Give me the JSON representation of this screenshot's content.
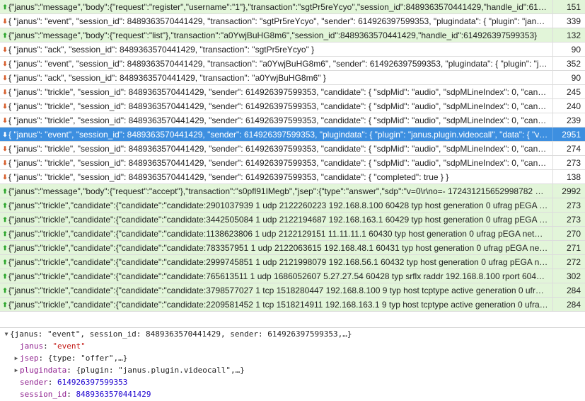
{
  "frames": [
    {
      "dir": "up",
      "type": "sent",
      "text": "{\"janus\":\"message\",\"body\":{\"request\":\"register\",\"username\":\"1\"},\"transaction\":\"sgtPr5reYcyo\",\"session_id\":8489363570441429,\"handle_id\":614926…",
      "length": "151"
    },
    {
      "dir": "down",
      "type": "received",
      "text": "{ \"janus\": \"event\", \"session_id\": 8489363570441429, \"transaction\": \"sgtPr5reYcyo\", \"sender\": 614926397599353, \"plugindata\": { \"plugin\": \"janus.pl…",
      "length": "339"
    },
    {
      "dir": "up",
      "type": "sent",
      "text": "{\"janus\":\"message\",\"body\":{\"request\":\"list\"},\"transaction\":\"a0YwjBuHG8m6\",\"session_id\":8489363570441429,\"handle_id\":614926397599353}",
      "length": "132"
    },
    {
      "dir": "down",
      "type": "received",
      "text": "{ \"janus\": \"ack\", \"session_id\": 8489363570441429, \"transaction\": \"sgtPr5reYcyo\" }",
      "length": "90"
    },
    {
      "dir": "down",
      "type": "received",
      "text": "{ \"janus\": \"event\", \"session_id\": 8489363570441429, \"transaction\": \"a0YwjBuHG8m6\", \"sender\": 614926397599353, \"plugindata\": { \"plugin\": \"janu…",
      "length": "352"
    },
    {
      "dir": "down",
      "type": "received",
      "text": "{ \"janus\": \"ack\", \"session_id\": 8489363570441429, \"transaction\": \"a0YwjBuHG8m6\" }",
      "length": "90"
    },
    {
      "dir": "down",
      "type": "received",
      "text": "{ \"janus\": \"trickle\", \"session_id\": 8489363570441429, \"sender\": 614926397599353, \"candidate\": { \"sdpMid\": \"audio\", \"sdpMLineIndex\": 0, \"candid…",
      "length": "245"
    },
    {
      "dir": "down",
      "type": "received",
      "text": "{ \"janus\": \"trickle\", \"session_id\": 8489363570441429, \"sender\": 614926397599353, \"candidate\": { \"sdpMid\": \"audio\", \"sdpMLineIndex\": 0, \"candid…",
      "length": "240"
    },
    {
      "dir": "down",
      "type": "received",
      "text": "{ \"janus\": \"trickle\", \"session_id\": 8489363570441429, \"sender\": 614926397599353, \"candidate\": { \"sdpMid\": \"audio\", \"sdpMLineIndex\": 0, \"candid…",
      "length": "239"
    },
    {
      "dir": "down",
      "type": "selected",
      "text": "{ \"janus\": \"event\", \"session_id\": 8489363570441429, \"sender\": 614926397599353, \"plugindata\": { \"plugin\": \"janus.plugin.videocall\", \"data\": { \"vide…",
      "length": "2951"
    },
    {
      "dir": "down",
      "type": "received",
      "text": "{ \"janus\": \"trickle\", \"session_id\": 8489363570441429, \"sender\": 614926397599353, \"candidate\": { \"sdpMid\": \"audio\", \"sdpMLineIndex\": 0, \"candid…",
      "length": "274"
    },
    {
      "dir": "down",
      "type": "received",
      "text": "{ \"janus\": \"trickle\", \"session_id\": 8489363570441429, \"sender\": 614926397599353, \"candidate\": { \"sdpMid\": \"audio\", \"sdpMLineIndex\": 0, \"candid…",
      "length": "273"
    },
    {
      "dir": "down",
      "type": "received",
      "text": "{ \"janus\": \"trickle\", \"session_id\": 8489363570441429, \"sender\": 614926397599353, \"candidate\": { \"completed\": true } }",
      "length": "138"
    },
    {
      "dir": "up",
      "type": "sent",
      "text": "{\"janus\":\"message\",\"body\":{\"request\":\"accept\"},\"transaction\":\"s0pfl91IMegb\",\"jsep\":{\"type\":\"answer\",\"sdp\":\"v=0\\r\\no=- 172431215652998782 2 I…",
      "length": "2992"
    },
    {
      "dir": "up",
      "type": "sent",
      "text": "{\"janus\":\"trickle\",\"candidate\":{\"candidate\":\"candidate:2901037939 1 udp 2122260223 192.168.8.100 60428 typ host generation 0 ufrag pEGA net…",
      "length": "273"
    },
    {
      "dir": "up",
      "type": "sent",
      "text": "{\"janus\":\"trickle\",\"candidate\":{\"candidate\":\"candidate:3442505084 1 udp 2122194687 192.168.163.1 60429 typ host generation 0 ufrag pEGA net…",
      "length": "273"
    },
    {
      "dir": "up",
      "type": "sent",
      "text": "{\"janus\":\"trickle\",\"candidate\":{\"candidate\":\"candidate:1138623806 1 udp 2122129151 11.11.11.1 60430 typ host generation 0 ufrag pEGA networ…",
      "length": "270"
    },
    {
      "dir": "up",
      "type": "sent",
      "text": "{\"janus\":\"trickle\",\"candidate\":{\"candidate\":\"candidate:783357951 1 udp 2122063615 192.168.48.1 60431 typ host generation 0 ufrag pEGA netw…",
      "length": "271"
    },
    {
      "dir": "up",
      "type": "sent",
      "text": "{\"janus\":\"trickle\",\"candidate\":{\"candidate\":\"candidate:2999745851 1 udp 2121998079 192.168.56.1 60432 typ host generation 0 ufrag pEGA net…",
      "length": "272"
    },
    {
      "dir": "up",
      "type": "sent",
      "text": "{\"janus\":\"trickle\",\"candidate\":{\"candidate\":\"candidate:765613511 1 udp 1686052607 5.27.27.54 60428 typ srflx raddr 192.168.8.100 rport 60428 …",
      "length": "302"
    },
    {
      "dir": "up",
      "type": "sent",
      "text": "{\"janus\":\"trickle\",\"candidate\":{\"candidate\":\"candidate:3798577027 1 tcp 1518280447 192.168.8.100 9 typ host tcptype active generation 0 ufrag …",
      "length": "284"
    },
    {
      "dir": "up",
      "type": "sent",
      "text": "{\"janus\":\"trickle\",\"candidate\":{\"candidate\":\"candidate:2209581452 1 tcp 1518214911 192.168.163.1 9 typ host tcptype active generation 0 ufrag …",
      "length": "284"
    }
  ],
  "detail": {
    "summary": "{janus: \"event\", session_id: 8489363570441429, sender: 614926397599353,…}",
    "lines": [
      {
        "kind": "string",
        "key": "janus",
        "value": "\"event\"",
        "expander": false
      },
      {
        "kind": "object",
        "key": "jsep",
        "value": "{type: \"offer\",…}",
        "expander": true
      },
      {
        "kind": "object",
        "key": "plugindata",
        "value": "{plugin: \"janus.plugin.videocall\",…}",
        "expander": true
      },
      {
        "kind": "number",
        "key": "sender",
        "value": "614926397599353",
        "expander": false
      },
      {
        "kind": "number",
        "key": "session_id",
        "value": "8489363570441429",
        "expander": false
      }
    ]
  },
  "icons": {
    "sent_arrow": "arrow-up-icon",
    "received_arrow": "arrow-down-icon",
    "expanded_triangle": "triangle-down-icon",
    "collapsed_triangle": "triangle-right-icon"
  },
  "colors": {
    "sent_row": "#e2f5d9",
    "selected_row": "#3d8fe0",
    "key": "#8e1e8e",
    "string": "#c41a16",
    "number": "#1c00cf"
  }
}
